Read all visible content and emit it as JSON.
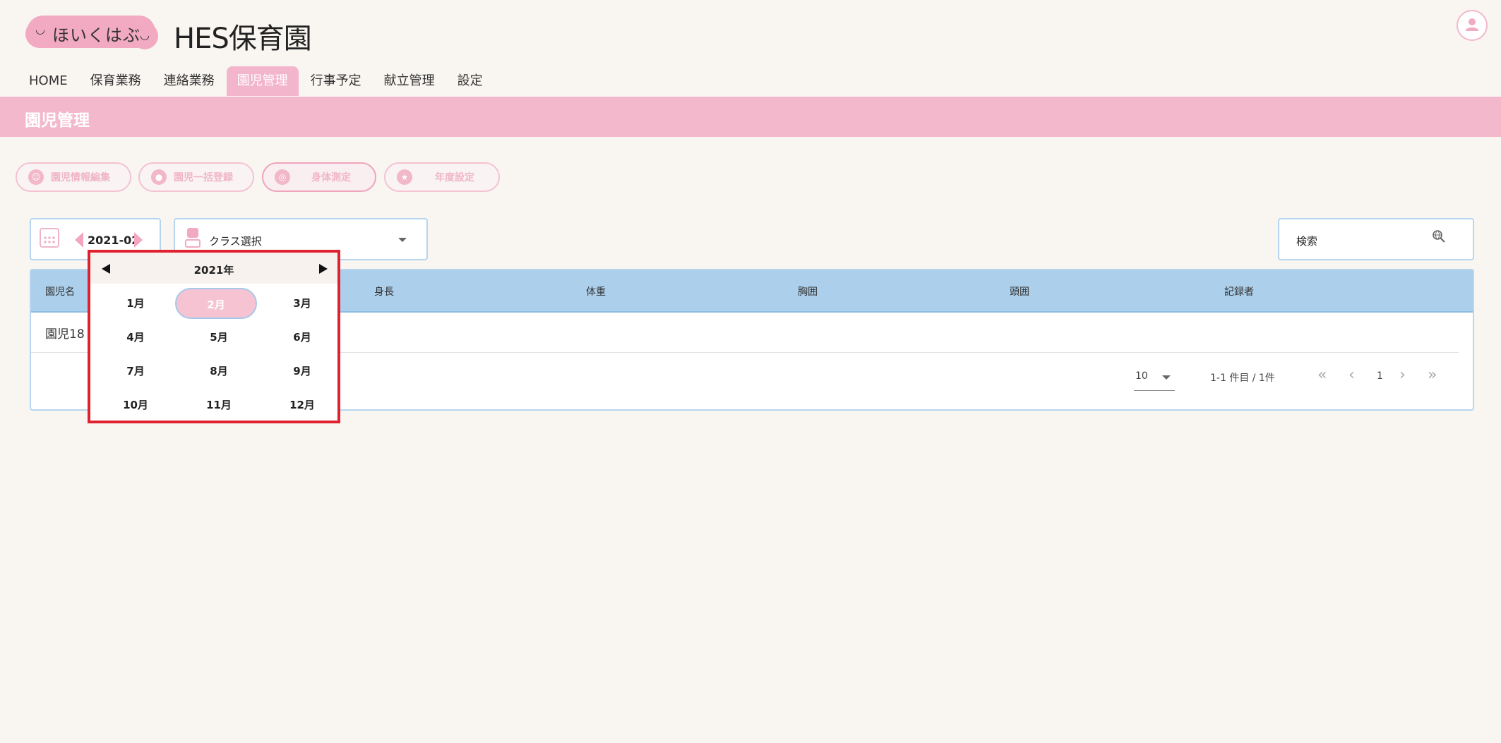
{
  "header": {
    "logo_text": "ほいくはぶ",
    "site_title": "HES保育園"
  },
  "nav": {
    "items": [
      {
        "label": "HOME",
        "active": false
      },
      {
        "label": "保育業務",
        "active": false
      },
      {
        "label": "連絡業務",
        "active": false
      },
      {
        "label": "園児管理",
        "active": true
      },
      {
        "label": "行事予定",
        "active": false
      },
      {
        "label": "献立管理",
        "active": false
      },
      {
        "label": "設定",
        "active": false
      }
    ]
  },
  "banner": {
    "title": "園児管理"
  },
  "actions": [
    {
      "label": "園児情報編集",
      "icon": "child-face-icon"
    },
    {
      "label": "園児一括登録",
      "icon": "group-icon"
    },
    {
      "label": "身体測定",
      "icon": "measure-icon"
    },
    {
      "label": "年度設定",
      "icon": "star-icon"
    }
  ],
  "filters": {
    "month_value": "2021-02",
    "class_select": "クラス選択",
    "search_placeholder": "検索"
  },
  "table": {
    "columns": [
      "園児名",
      "身長",
      "体重",
      "胸囲",
      "頭囲",
      "記録者"
    ],
    "rows": [
      [
        "園児18",
        "",
        "",
        "",
        "",
        ""
      ]
    ],
    "per_page": "10",
    "range_text": "1-1 件目 / 1件",
    "page": "1"
  },
  "month_picker": {
    "year_label": "2021年",
    "months": [
      "1月",
      "2月",
      "3月",
      "4月",
      "5月",
      "6月",
      "7月",
      "8月",
      "9月",
      "10月",
      "11月",
      "12月"
    ],
    "selected_index": 1
  },
  "colors": {
    "accent_pink": "#f4b8cc",
    "table_header_blue": "#acd0ec",
    "highlight_red": "#e02230"
  }
}
